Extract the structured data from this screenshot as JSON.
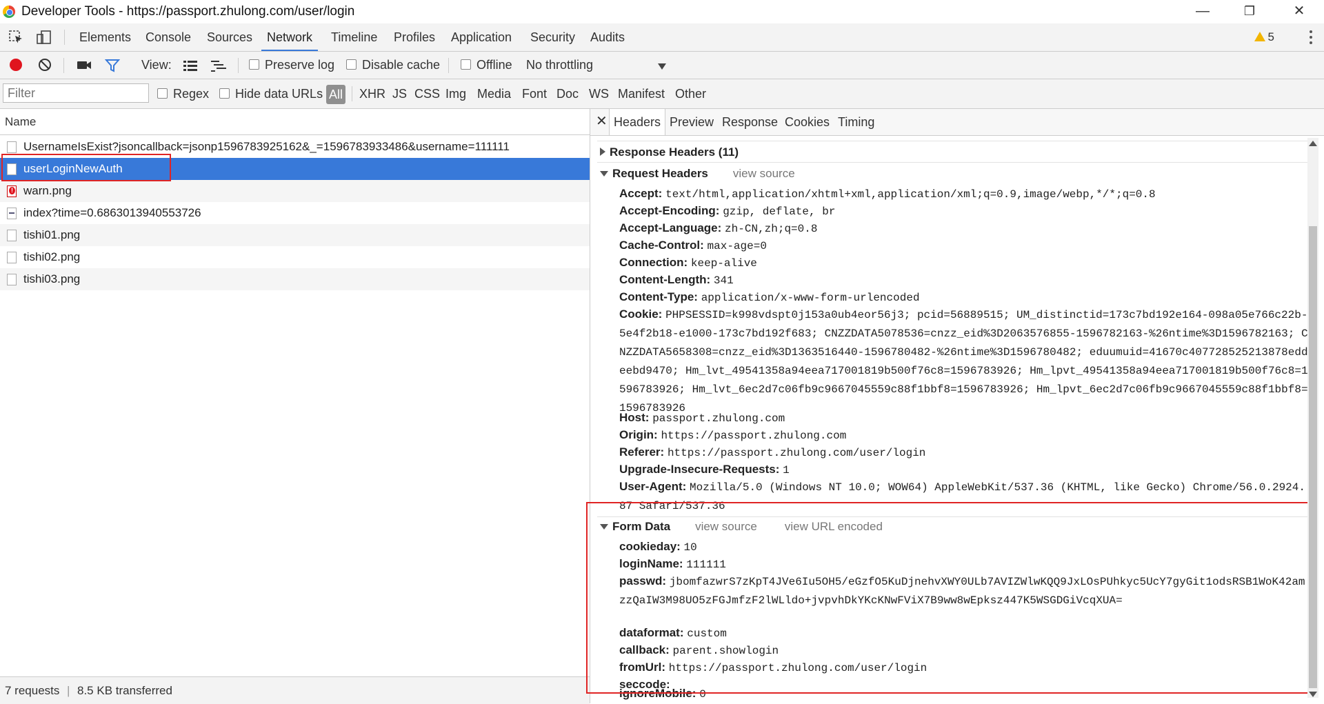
{
  "window": {
    "title": "Developer Tools - https://passport.zhulong.com/user/login",
    "minimize": "—",
    "restore": "❐",
    "close": "✕"
  },
  "tabs": [
    "Elements",
    "Console",
    "Sources",
    "Network",
    "Timeline",
    "Profiles",
    "Application",
    "Security",
    "Audits"
  ],
  "warnings": "5",
  "toolbar": {
    "view_label": "View:",
    "preserve_log": "Preserve log",
    "disable_cache": "Disable cache",
    "offline": "Offline",
    "throttling": "No throttling"
  },
  "filter": {
    "placeholder": "Filter",
    "regex": "Regex",
    "hide_data_urls": "Hide data URLs",
    "types": [
      "All",
      "XHR",
      "JS",
      "CSS",
      "Img",
      "Media",
      "Font",
      "Doc",
      "WS",
      "Manifest",
      "Other"
    ]
  },
  "requests": {
    "header": "Name",
    "rows": [
      "UsernameIsExist?jsoncallback=jsonp1596783925162&_=1596783933486&username=111111",
      "userLoginNewAuth",
      "warn.png",
      "index?time=0.6863013940553726",
      "tishi01.png",
      "tishi02.png",
      "tishi03.png"
    ]
  },
  "status": {
    "requests": "7 requests",
    "separator": "|",
    "transferred": "8.5 KB transferred"
  },
  "detail": {
    "close": "✕",
    "tabs": [
      "Headers",
      "Preview",
      "Response",
      "Cookies",
      "Timing"
    ],
    "response_headers": "Response Headers (11)",
    "request_headers": "Request Headers",
    "view_source": "view source",
    "view_url_encoded": "view URL encoded",
    "form_data": "Form Data",
    "headers": [
      {
        "k": "Accept:",
        "v": "text/html,application/xhtml+xml,application/xml;q=0.9,image/webp,*/*;q=0.8"
      },
      {
        "k": "Accept-Encoding:",
        "v": "gzip, deflate, br"
      },
      {
        "k": "Accept-Language:",
        "v": "zh-CN,zh;q=0.8"
      },
      {
        "k": "Cache-Control:",
        "v": "max-age=0"
      },
      {
        "k": "Connection:",
        "v": "keep-alive"
      },
      {
        "k": "Content-Length:",
        "v": "341"
      },
      {
        "k": "Content-Type:",
        "v": "application/x-www-form-urlencoded"
      },
      {
        "k": "Cookie:",
        "v": "PHPSESSID=k998vdspt0j153a0ub4eor56j3; pcid=56889515; UM_distinctid=173c7bd192e164-098a05e766c22b-5e4f2b18-e1000-173c7bd192f683; CNZZDATA5078536=cnzz_eid%3D2063576855-1596782163-%26ntime%3D1596782163; CNZZDATA5658308=cnzz_eid%3D1363516440-1596780482-%26ntime%3D1596780482; eduumuid=41670c407728525213878eddeebd9470; Hm_lvt_49541358a94eea717001819b500f76c8=1596783926; Hm_lpvt_49541358a94eea717001819b500f76c8=1596783926; Hm_lvt_6ec2d7c06fb9c9667045559c88f1bbf8=1596783926; Hm_lpvt_6ec2d7c06fb9c9667045559c88f1bbf8=1596783926"
      },
      {
        "k": "Host:",
        "v": "passport.zhulong.com"
      },
      {
        "k": "Origin:",
        "v": "https://passport.zhulong.com"
      },
      {
        "k": "Referer:",
        "v": "https://passport.zhulong.com/user/login"
      },
      {
        "k": "Upgrade-Insecure-Requests:",
        "v": "1"
      },
      {
        "k": "User-Agent:",
        "v": "Mozilla/5.0 (Windows NT 10.0; WOW64) AppleWebKit/537.36 (KHTML, like Gecko) Chrome/56.0.2924.87 Safari/537.36"
      }
    ],
    "form": [
      {
        "k": "cookieday:",
        "v": "10"
      },
      {
        "k": "loginName:",
        "v": "111111"
      },
      {
        "k": "passwd:",
        "v": "jbomfazwrS7zKpT4JVe6Iu5OH5/eGzfO5KuDjnehvXWY0ULb7AVIZWlwKQQ9JxLOsPUhkyc5UcY7gyGit1odsRSB1WoK42amzzQaIW3M98UO5zFGJmfzF2lWLldo+jvpvhDkYKcKNwFViX7B9ww8wEpksz447K5WSGDGiVcqXUA="
      },
      {
        "k": "dataformat:",
        "v": "custom"
      },
      {
        "k": "callback:",
        "v": "parent.showlogin"
      },
      {
        "k": "fromUrl:",
        "v": "https://passport.zhulong.com/user/login"
      },
      {
        "k": "seccode:",
        "v": ""
      },
      {
        "k": "ignoreMobile:",
        "v": "0"
      }
    ]
  }
}
